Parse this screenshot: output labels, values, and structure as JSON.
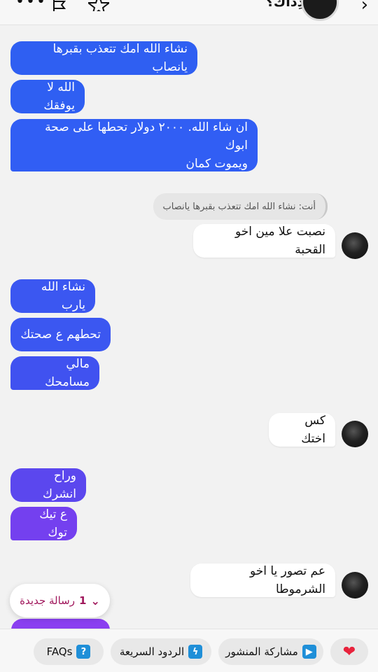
{
  "header": {
    "title": "فدِداك؟",
    "back_icon": "chevron-right-icon",
    "more_icon": "more-icon",
    "flag_icon": "flag-icon",
    "star_icon": "star-icon"
  },
  "colors": {
    "bubble_blue": "#2f5ff2",
    "bubble_purple": "#7a3ff2",
    "incoming": "#ffffff",
    "newmsg_text": "#a0175c"
  },
  "messages": [
    {
      "text": "نشاء الله امك تتعذب بقبرها يانصاب"
    },
    {
      "text": "الله لا يوفقك"
    },
    {
      "text": "ان شاء الله. ٢٠٠٠ دولار تحطها على صحة ابوك\nويموت كمان"
    },
    {
      "quote": "أنت: نشاء الله امك تتعذب بقبرها يانصاب"
    },
    {
      "text": "نصبت علا مين اخو القحبة"
    },
    {
      "text": "نشاء الله يارب"
    },
    {
      "text": "تحطهم ع صحتك"
    },
    {
      "text": "مالي مسامحك"
    },
    {
      "text": "كس اختك"
    },
    {
      "text": "وراح انشرك"
    },
    {
      "text": "ع تيك توك"
    },
    {
      "text": "عم تصور يا اخو الشرموطا"
    }
  ],
  "new_message_pill": {
    "count": "1",
    "label": "رسالة جديدة"
  },
  "bottom_bar": {
    "share_post": "مشاركة المنشور",
    "quick_replies": "الردود السريعة",
    "faqs": "FAQs",
    "share_icon": "play-icon",
    "quick_icon": "lightning-icon",
    "faq_icon": "question-icon",
    "heart_icon": "heart-icon"
  }
}
